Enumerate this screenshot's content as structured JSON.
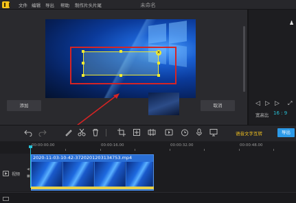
{
  "app": {
    "title": "未命名",
    "menu": [
      "文件",
      "编辑",
      "导出",
      "帮助",
      "制作片头片尾"
    ]
  },
  "preview": {
    "add_label": "添加",
    "cancel_label": "取消"
  },
  "right_pane": {
    "ratio_label": "宽高比",
    "ratio_value": "16 : 9",
    "controls": [
      "prev-frame",
      "play",
      "next-frame",
      "fullscreen"
    ]
  },
  "toolbar": {
    "tools": [
      "undo",
      "redo",
      "brush",
      "cut",
      "delete",
      "crop",
      "freeze",
      "mosaic",
      "speed",
      "timer",
      "mic",
      "record"
    ],
    "speech_label": "语音文字互转",
    "export_label": "导出"
  },
  "timeline": {
    "ruler_labels": [
      "00:00:00.00",
      "00:00:16.00",
      "00:00:32.00",
      "00:00:48.00"
    ],
    "track_label": "视频",
    "clip_name": "2020-11-03-10-42-3720201203134753.mp4"
  },
  "colors": {
    "accent_cyan": "#27c2d8",
    "export_blue": "#2c9ae8",
    "highlight_red": "#d62424",
    "selection_yellow": "#f0ea30",
    "speech_yellow": "#f0c020",
    "logo_yellow": "#f4c21a"
  }
}
